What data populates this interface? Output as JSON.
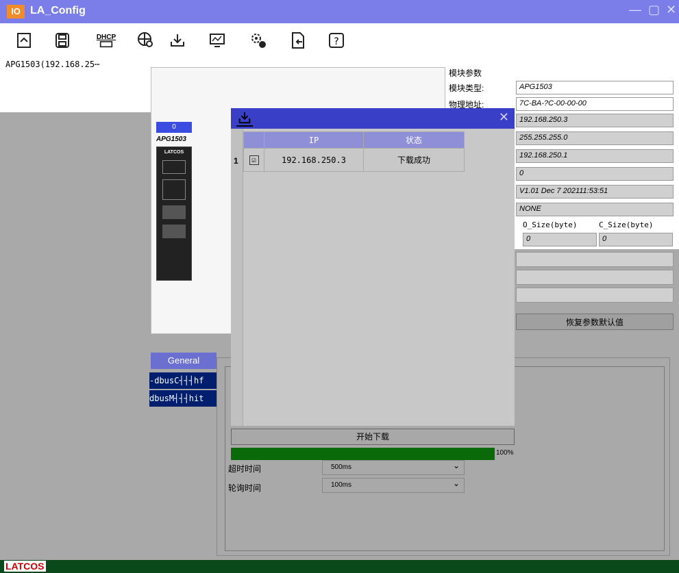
{
  "window": {
    "logo": "IO",
    "title": "LA_Config",
    "minimize": "—",
    "maximize": "▢",
    "close": "✕"
  },
  "toolbar": {
    "dhcp_label": "DHCP"
  },
  "tree": {
    "items": [
      {
        "label": "APG1503(192.168.25⋯"
      }
    ]
  },
  "module": {
    "number": "0",
    "name": "APG1503",
    "brand": "LATCOS"
  },
  "params": {
    "group_title": "模块参数",
    "type_label": "模块类型:",
    "type_value": "APG1503",
    "mac_label": "物理地址:",
    "mac_value": "7C-BA-?C-00-00-00",
    "ip_value": "192.168.250.3",
    "mask_value": "255.255.255.0",
    "gateway_value": "192.168.250.1",
    "val_zero": "0",
    "version_value": "V1.01 Dec 7 202111:53:51",
    "none_value": "NONE",
    "o_size_label": "O_Size(byte)",
    "c_size_label": "C_Size(byte)",
    "o_size_value": "0",
    "c_size_value": "0",
    "restore_label": "恢复参数默认值"
  },
  "lower": {
    "general_tab": "General",
    "mbus1": "-dbusC┤┤┤hf",
    "mbus2": "dbusM┤┤┤hit",
    "timeout_label": "超时时间",
    "timeout_value": "500ms",
    "poll_label": "轮询时间",
    "poll_value": "100ms"
  },
  "dialog": {
    "close": "✕",
    "col_ip": "IP",
    "col_status": "状态",
    "rows": [
      {
        "num": "1",
        "checked": "☑",
        "ip": "192.168.250.3",
        "status": "下载成功"
      }
    ],
    "start_label": "开始下载",
    "progress": 100,
    "progress_text": "100%"
  },
  "statusbar": {
    "brand": "LATCOS"
  }
}
